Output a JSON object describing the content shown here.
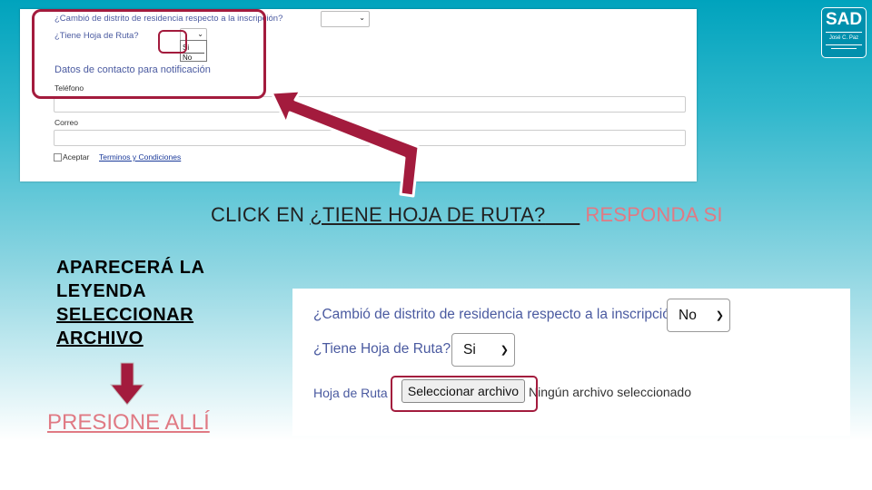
{
  "top_form": {
    "q_district": "¿Cambió de distrito de residencia respecto a la inscripción?",
    "q_route": "¿Tiene Hoja de Ruta?",
    "opt_si": "Si",
    "opt_no": "No",
    "contact_title": "Datos de contacto para notificación",
    "phone_label": "Teléfono",
    "email_label": "Correo",
    "accept_text": "Aceptar",
    "terms_link": "Terminos y Condiciones"
  },
  "caption": {
    "click_prefix": "CLICK EN ",
    "click_target": "¿TIENE HOJA DE RUTA?",
    "respond": "RESPONDA SI"
  },
  "logo": {
    "title": "SAD",
    "line1": "José C. Paz"
  },
  "left_text": {
    "line1": "APARECERÁ LA",
    "line2": "LEYENDA",
    "line3": "SELECCIONAR",
    "line4": "ARCHIVO",
    "press": "PRESIONE ALLÍ"
  },
  "bottom_form": {
    "q_district": "¿Cambió de distrito de residencia respecto a la inscripción?",
    "district_value": "No",
    "q_route": "¿Tiene Hoja de Ruta?",
    "route_value": "Si",
    "route_sheet_label": "Hoja de Ruta",
    "file_button": "Seleccionar archivo",
    "file_status": "Ningún archivo seleccionado"
  },
  "colors": {
    "accent": "#a31b3d",
    "pink": "#e07a84",
    "teal": "#00a3bd"
  }
}
